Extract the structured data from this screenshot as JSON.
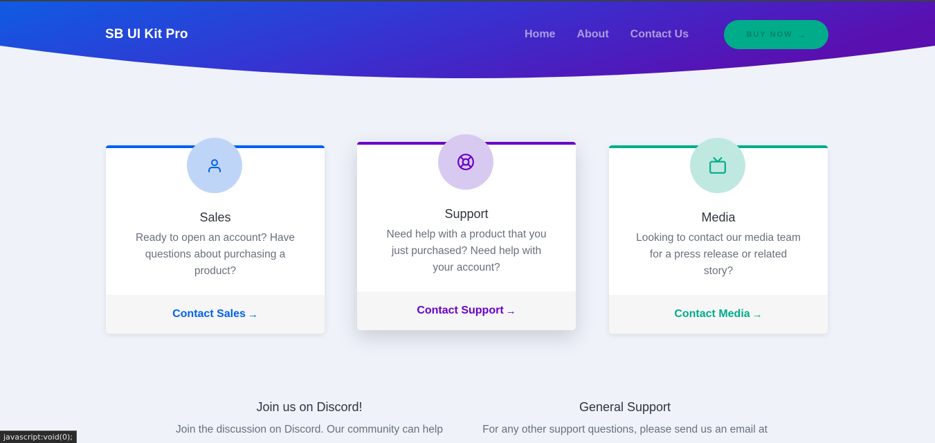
{
  "header": {
    "brand": "SB UI Kit Pro",
    "nav": [
      "Home",
      "About",
      "Contact Us"
    ],
    "buy_label": "BUY NOW",
    "gradient_start": "#0f5ce3",
    "gradient_end": "#5a0fb0"
  },
  "cards": [
    {
      "title": "Sales",
      "text": "Ready to open an account? Have questions about purchasing a product?",
      "link": "Contact Sales",
      "icon": "user-icon",
      "accent": "#0061f2",
      "circle": "#bfd5f8"
    },
    {
      "title": "Support",
      "text": "Need help with a product that you just purchased? Need help with your account?",
      "link": "Contact Support",
      "icon": "life-buoy-icon",
      "accent": "#6900c7",
      "circle": "#d8c9f1"
    },
    {
      "title": "Media",
      "text": "Looking to contact our media team for a press release or related story?",
      "link": "Contact Media",
      "icon": "tv-icon",
      "accent": "#00ac8a",
      "circle": "#bfe8e1"
    }
  ],
  "bottom": {
    "discord_title": "Join us on Discord!",
    "discord_text": "Join the discussion on Discord. Our community can help",
    "support_title": "General Support",
    "support_text": "For any other support questions, please send us an email at"
  },
  "status_bar": "javascript:void(0);"
}
